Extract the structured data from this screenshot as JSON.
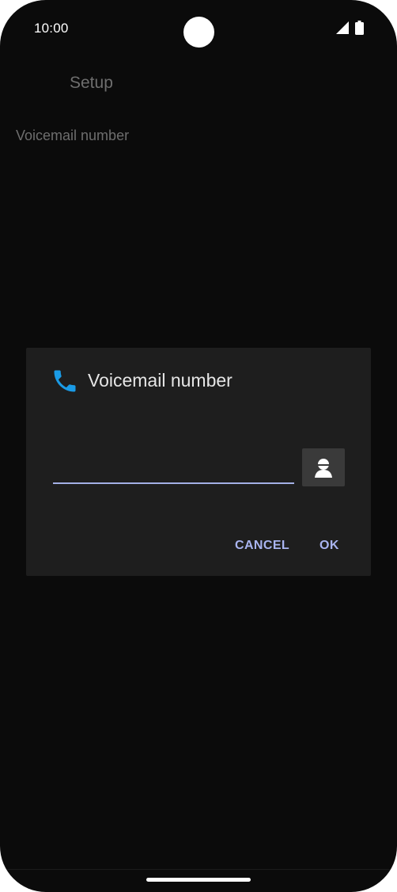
{
  "status_bar": {
    "time": "10:00"
  },
  "screen": {
    "title": "Setup",
    "items": [
      {
        "label": "Voicemail number"
      }
    ]
  },
  "dialog": {
    "title": "Voicemail number",
    "icon": "phone-icon",
    "input": {
      "value": "",
      "placeholder": ""
    },
    "contact_icon": "contact-icon",
    "buttons": {
      "cancel": "CANCEL",
      "ok": "OK"
    }
  },
  "colors": {
    "accent": "#a9b4f0",
    "phone_icon": "#1a9be6",
    "background": "#0b0b0b",
    "dialog_bg": "#1e1e1e"
  }
}
